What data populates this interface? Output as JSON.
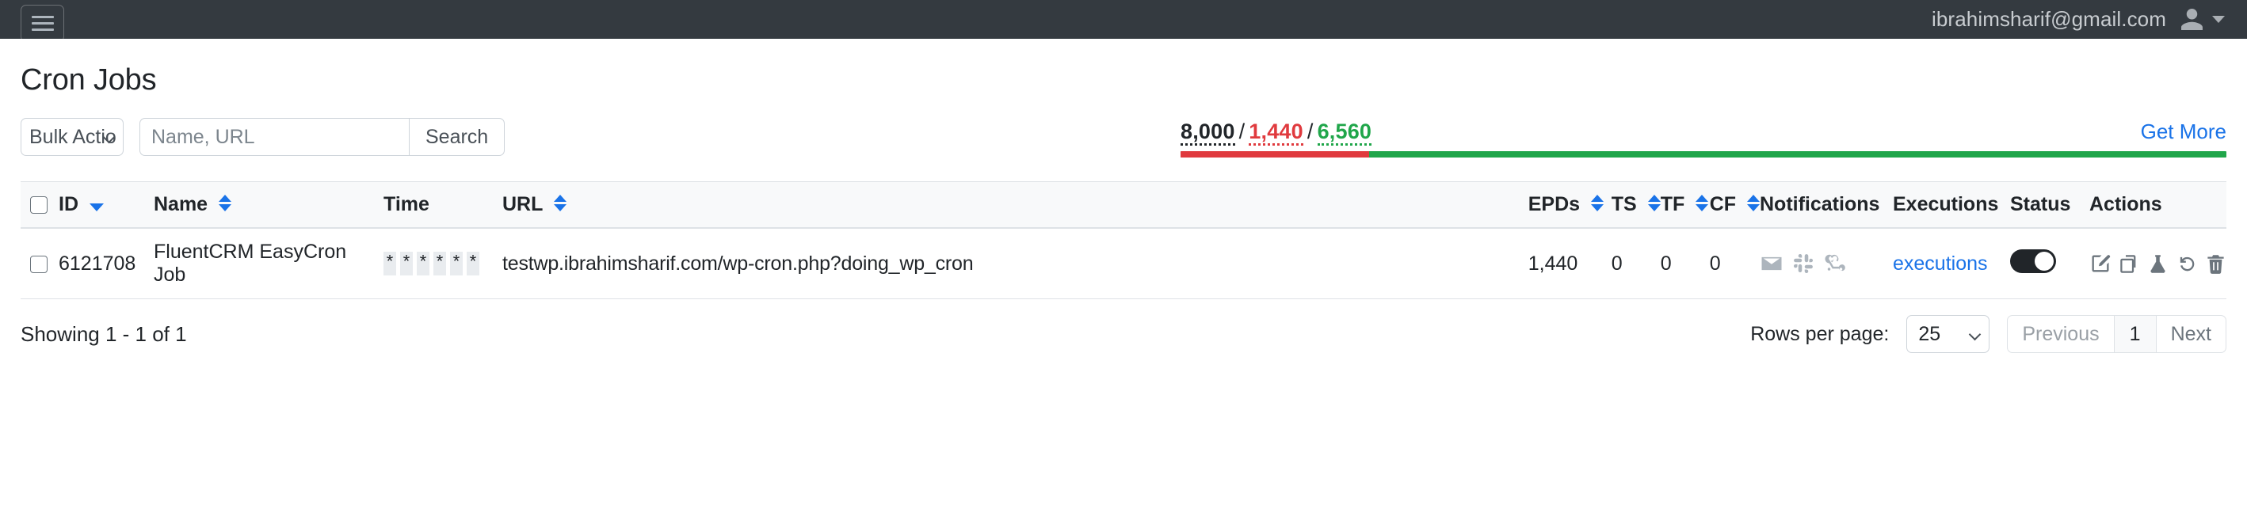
{
  "topbar": {
    "menu_icon": "hamburger-icon",
    "user_email": "ibrahimsharif@gmail.com",
    "avatar_icon": "user-avatar-icon",
    "caret_icon": "chevron-down-icon"
  },
  "page": {
    "title": "Cron Jobs"
  },
  "controls": {
    "bulk_action_value": "Bulk Action",
    "bulk_action_options": [
      "Bulk Action"
    ],
    "search_placeholder": "Name, URL",
    "search_value": "",
    "search_button": "Search"
  },
  "quota": {
    "total": "8,000",
    "used": "1,440",
    "remaining": "6,560",
    "separator": "/",
    "get_more_label": "Get More",
    "used_percent": 18,
    "colors": {
      "total": "#212529",
      "used": "#e03a3e",
      "remaining": "#20a64a",
      "link": "#1a73e8"
    }
  },
  "table": {
    "headers": {
      "id": "ID",
      "name": "Name",
      "time": "Time",
      "url": "URL",
      "epds": "EPDs",
      "ts": "TS",
      "tf": "TF",
      "cf": "CF",
      "notifications": "Notifications",
      "executions": "Executions",
      "status": "Status",
      "actions": "Actions"
    },
    "rows": [
      {
        "id": "6121708",
        "name": "FluentCRM EasyCron Job",
        "time": [
          "*",
          "*",
          "*",
          "*",
          "*",
          "*"
        ],
        "url": "testwp.ibrahimsharif.com/wp-cron.php?doing_wp_cron",
        "epds": "1,440",
        "ts": "0",
        "tf": "0",
        "cf": "0",
        "notifications": [
          "email-icon",
          "slack-icon",
          "webhook-icon"
        ],
        "executions_label": "executions",
        "status_enabled": true,
        "actions": [
          "edit-icon",
          "duplicate-icon",
          "test-flask-icon",
          "restore-icon",
          "delete-icon"
        ]
      }
    ]
  },
  "footer": {
    "showing": "Showing 1 - 1 of 1",
    "rows_per_page_label": "Rows per page:",
    "rows_per_page_value": "25",
    "rows_per_page_options": [
      "25"
    ],
    "previous_label": "Previous",
    "current_page": "1",
    "next_label": "Next"
  }
}
